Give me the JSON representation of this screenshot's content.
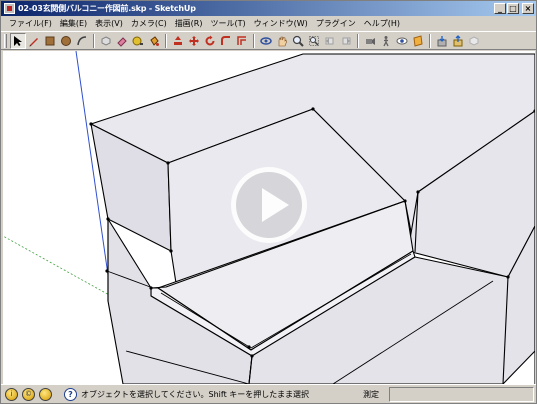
{
  "window": {
    "title": "02-03玄関側バルコニー作図前.skp - SketchUp",
    "buttons": {
      "minimize": "_",
      "maximize": "□",
      "close": "×"
    }
  },
  "menubar": {
    "items": [
      {
        "label": "ファイル(F)"
      },
      {
        "label": "編集(E)"
      },
      {
        "label": "表示(V)"
      },
      {
        "label": "カメラ(C)"
      },
      {
        "label": "描画(R)"
      },
      {
        "label": "ツール(T)"
      },
      {
        "label": "ウィンドウ(W)"
      },
      {
        "label": "プラグイン"
      },
      {
        "label": "ヘルプ(H)"
      }
    ]
  },
  "toolbar": {
    "tools": [
      {
        "icon": "select-arrow-icon",
        "active": true,
        "color": "#000000"
      },
      {
        "icon": "pencil-icon",
        "color": "#c03020"
      },
      {
        "icon": "rectangle-icon",
        "color": "#8b5a2b"
      },
      {
        "icon": "circle-icon",
        "color": "#8b5a2b"
      },
      {
        "icon": "arc-icon",
        "color": "#404040"
      },
      {
        "icon": "make-component-icon",
        "color": "#909090"
      },
      {
        "icon": "eraser-icon",
        "color": "#d06080"
      },
      {
        "icon": "tape-measure-icon",
        "color": "#c0a000"
      },
      {
        "icon": "paint-bucket-icon",
        "color": "#c03020"
      },
      {
        "icon": "push-pull-icon",
        "color": "#c03020"
      },
      {
        "icon": "move-icon",
        "color": "#c03020"
      },
      {
        "icon": "rotate-icon",
        "color": "#c03020"
      },
      {
        "icon": "follow-me-icon",
        "color": "#c03020"
      },
      {
        "icon": "offset-icon",
        "color": "#c03020"
      },
      {
        "icon": "orbit-icon",
        "color": "#3050a0"
      },
      {
        "icon": "pan-icon",
        "color": "#c08040"
      },
      {
        "icon": "zoom-icon",
        "color": "#404040"
      },
      {
        "icon": "zoom-extents-icon",
        "color": "#404040"
      },
      {
        "icon": "previous-view-icon",
        "color": "#a0a0a0"
      },
      {
        "icon": "next-view-icon",
        "color": "#a0a0a0"
      },
      {
        "icon": "position-camera-icon",
        "color": "#606060"
      },
      {
        "icon": "walk-icon",
        "color": "#606060"
      },
      {
        "icon": "look-around-icon",
        "color": "#606060"
      },
      {
        "icon": "section-plane-icon",
        "color": "#d08020"
      },
      {
        "icon": "get-models-icon",
        "color": "#606060"
      },
      {
        "icon": "share-model-icon",
        "color": "#c09020"
      },
      {
        "icon": "share-component-icon",
        "color": "#a0a0a0"
      }
    ]
  },
  "viewport": {
    "background": "#ffffff",
    "face_color": "#ecebf1",
    "edge_color": "#000000",
    "axis_colors": {
      "blue": "#3050d0",
      "green": "#40a040",
      "red": "#d03030"
    },
    "play_icon": "play-icon"
  },
  "statusbar": {
    "icons": [
      "geolocation-icon",
      "credits-icon",
      "user-icon",
      "help-icon"
    ],
    "icon_glyphs": [
      "i",
      "©",
      "?"
    ],
    "message": "オブジェクトを選択してください。Shift キーを押したまま選択",
    "measurement_label": "測定",
    "measurement_value": ""
  }
}
